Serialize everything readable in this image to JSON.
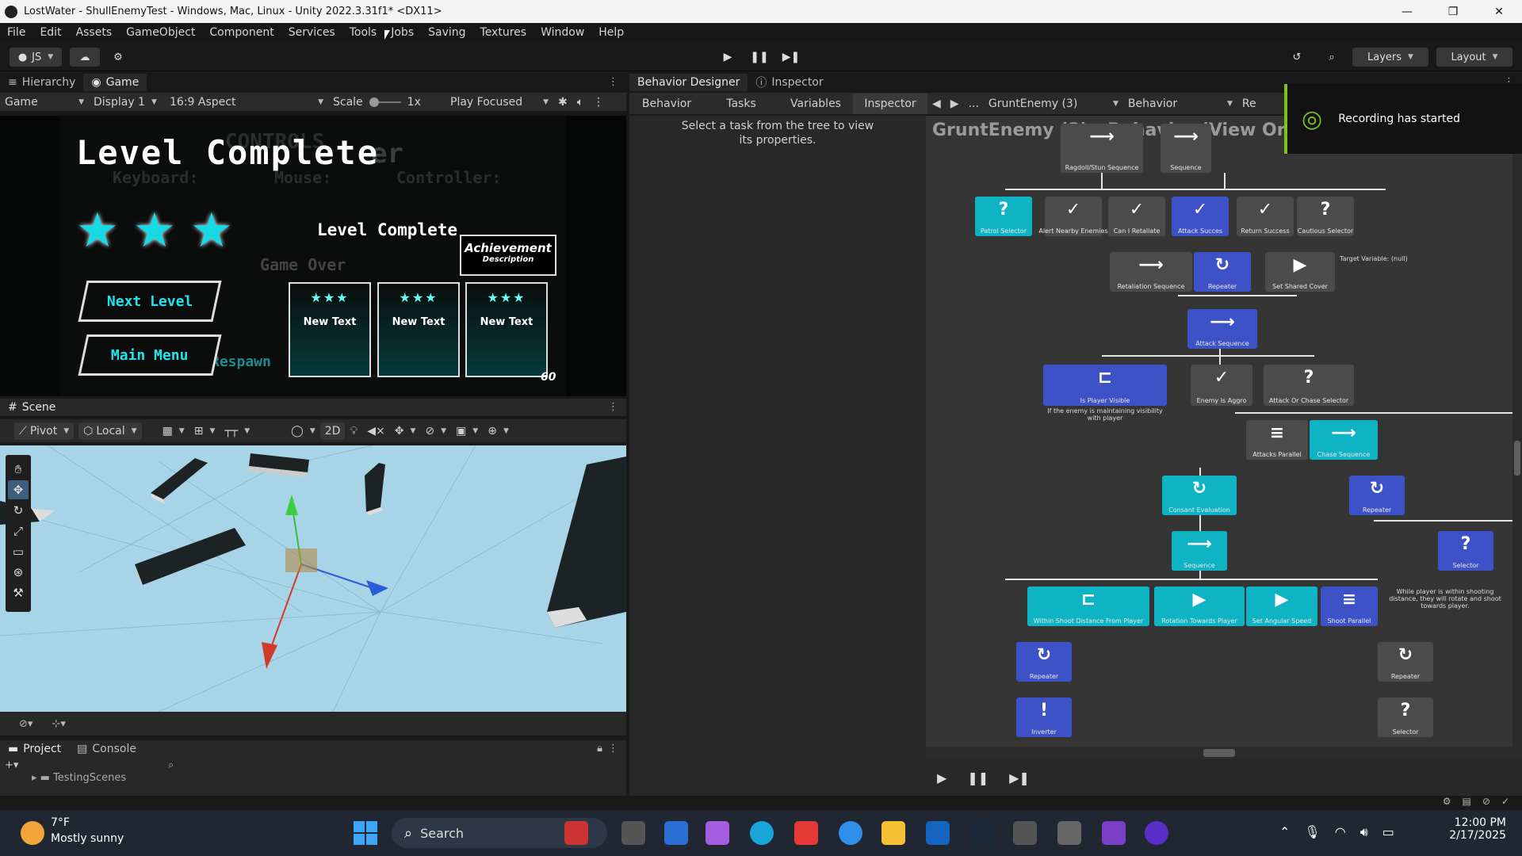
{
  "window": {
    "title": "LostWater - ShullEnemyTest - Windows, Mac, Linux - Unity 2022.3.31f1* <DX11>"
  },
  "menu": [
    "File",
    "Edit",
    "Assets",
    "GameObject",
    "Component",
    "Services",
    "Tools",
    "Jobs",
    "Saving",
    "Textures",
    "Window",
    "Help"
  ],
  "toolbar": {
    "account": "JS",
    "layers": "Layers",
    "layout": "Layout"
  },
  "hierarchy_tabs": {
    "hierarchy": "Hierarchy",
    "game": "Game"
  },
  "game_bar": {
    "mode": "Game",
    "display": "Display 1",
    "aspect": "16:9 Aspect",
    "scale_label": "Scale",
    "scale_value": "1x",
    "play_mode": "Play Focused"
  },
  "game_view": {
    "title": "Level Complete",
    "ghost_text": [
      "CONTROLS",
      "Keyboard:",
      "Mouse:",
      "Controller:",
      "Game Over",
      "Respawn",
      "er"
    ],
    "subtitle": "Level Complete",
    "achievement": "Achievement",
    "description": "Description",
    "next_button": "Next Level",
    "menu_button": "Main Menu",
    "cards": [
      "New Text",
      "New Text",
      "New Text"
    ],
    "card_stars": "★★★",
    "fps": "60"
  },
  "scene": {
    "tab": "Scene",
    "pivot": "Pivot",
    "local": "Local",
    "mode_2d": "2D"
  },
  "project": {
    "tab_project": "Project",
    "tab_console": "Console",
    "folder": "TestingScenes"
  },
  "behavior_designer": {
    "tab": "Behavior Designer",
    "inspector_tab": "Inspector",
    "subtabs": [
      "Behavior",
      "Tasks",
      "Variables",
      "Inspector"
    ],
    "selected_object": "GruntEnemy (3)",
    "behavior": "Behavior",
    "ref_label": "Re",
    "empty_message": "Select a task from the tree to view its properties.",
    "graph_title": "GruntEnemy (3) - Behavior (View Only Mode)",
    "notification": "Recording has started",
    "nodes": {
      "ragdoll": "Ragdoll/Stun Sequence",
      "sequence_top": "Sequence",
      "patrol": "Patrol Selector",
      "alert": "Alert Nearby Enemies",
      "retaliate": "Can I Retaliate",
      "attack_success": "Attack Succes",
      "return_success": "Return Success",
      "cautious": "Cautious Selector",
      "retaliation": "Retaliation Sequence",
      "repeater1": "Repeater",
      "shared_cover": "Set Shared Cover",
      "target_var": "Target Variable: (null)",
      "attack_seq": "Attack Sequence",
      "player_visible": "Is Player Visible",
      "player_visible_note": "If the enemy is maintaining visibility with player",
      "aggro": "Enemy Is Aggro",
      "attack_chase": "Attack Or Chase Selector",
      "attacks_parallel": "Attacks Parallel",
      "chase_seq": "Chase Sequence",
      "consant": "Consant Evaluation",
      "repeater2": "Repeater",
      "sequence2": "Sequence",
      "selector1": "Selector",
      "within_shoot": "Within Shoot Distance From Player",
      "rotation": "Rotation Towards Player",
      "angular": "Set Angular Speed",
      "shoot_parallel": "Shoot Parallel",
      "shoot_note": "While player is within shooting distance, they will rotate and shoot towards player.",
      "repeater3": "Repeater",
      "repeater4": "Repeater",
      "inverter": "Inverter",
      "selector2": "Selector"
    }
  },
  "taskbar": {
    "temp": "7°F",
    "weather": "Mostly sunny",
    "search": "Search",
    "time": "12:00 PM",
    "date": "2/17/2025"
  }
}
